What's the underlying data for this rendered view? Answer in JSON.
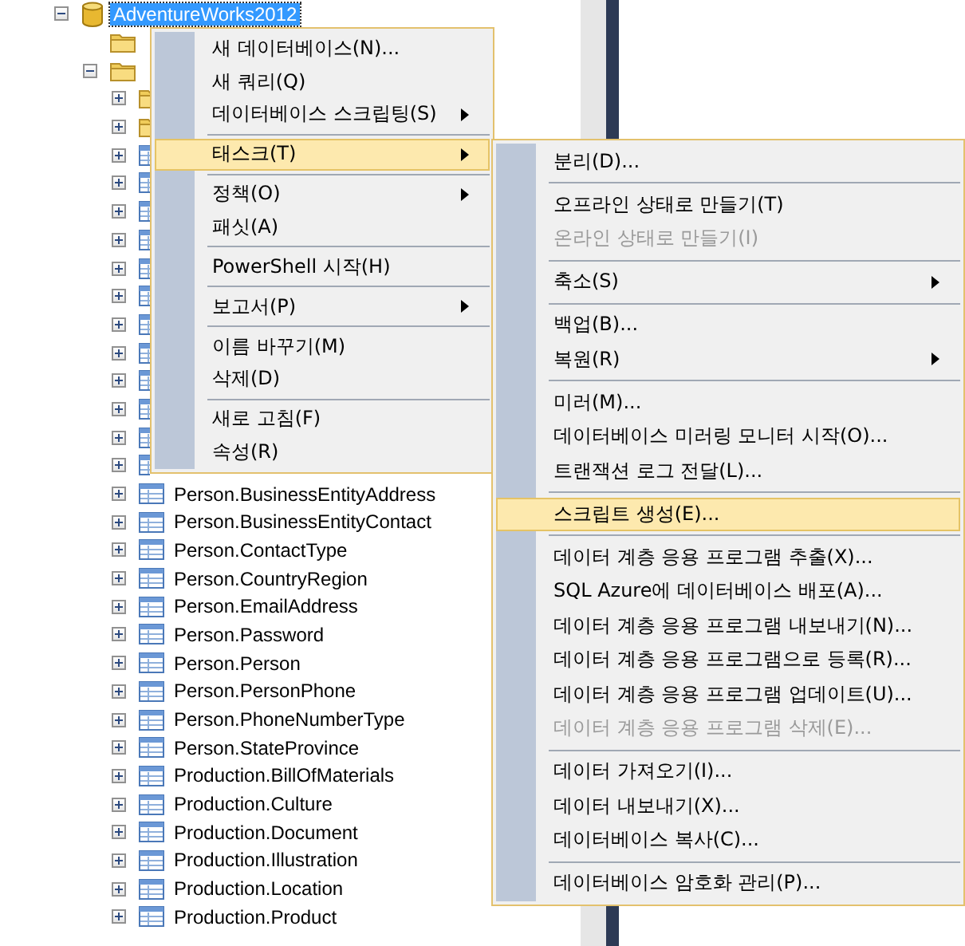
{
  "tree": {
    "nodes": [
      {
        "label": "AdventureWorks2012",
        "kind": "database",
        "expanded": true,
        "selected": true,
        "children": [
          {
            "kind": "folder"
          },
          {
            "kind": "folder",
            "expanded": true,
            "children": [
              {
                "kind": "folder",
                "expanded": false
              },
              {
                "kind": "folder",
                "expanded": false
              },
              {
                "kind": "table",
                "expanded": false
              },
              {
                "kind": "table",
                "expanded": false
              },
              {
                "kind": "table",
                "expanded": false
              },
              {
                "kind": "table",
                "expanded": false
              },
              {
                "kind": "table",
                "expanded": false
              },
              {
                "kind": "table",
                "expanded": false
              },
              {
                "kind": "table",
                "expanded": false
              },
              {
                "kind": "table",
                "expanded": false
              },
              {
                "kind": "table",
                "expanded": false
              },
              {
                "kind": "table",
                "expanded": false
              },
              {
                "kind": "table",
                "expanded": false
              },
              {
                "kind": "table",
                "expanded": false
              },
              {
                "label": "Person.BusinessEntityAddress",
                "kind": "table",
                "expanded": false,
                "selected": false
              },
              {
                "label": "Person.BusinessEntityContact",
                "kind": "table",
                "expanded": false,
                "selected": false
              },
              {
                "label": "Person.ContactType",
                "kind": "table",
                "expanded": false,
                "selected": false
              },
              {
                "label": "Person.CountryRegion",
                "kind": "table",
                "expanded": false,
                "selected": false
              },
              {
                "label": "Person.EmailAddress",
                "kind": "table",
                "expanded": false,
                "selected": false
              },
              {
                "label": "Person.Password",
                "kind": "table",
                "expanded": false,
                "selected": false
              },
              {
                "label": "Person.Person",
                "kind": "table",
                "expanded": false,
                "selected": false
              },
              {
                "label": "Person.PersonPhone",
                "kind": "table",
                "expanded": false,
                "selected": false
              },
              {
                "label": "Person.PhoneNumberType",
                "kind": "table",
                "expanded": false,
                "selected": false
              },
              {
                "label": "Person.StateProvince",
                "kind": "table",
                "expanded": false,
                "selected": false
              },
              {
                "label": "Production.BillOfMaterials",
                "kind": "table",
                "expanded": false,
                "selected": false
              },
              {
                "label": "Production.Culture",
                "kind": "table",
                "expanded": false,
                "selected": false
              },
              {
                "label": "Production.Document",
                "kind": "table",
                "expanded": false,
                "selected": false
              },
              {
                "label": "Production.Illustration",
                "kind": "table",
                "expanded": false,
                "selected": false
              },
              {
                "label": "Production.Location",
                "kind": "table",
                "expanded": false,
                "selected": false
              },
              {
                "label": "Production.Product",
                "kind": "table",
                "expanded": false,
                "selected": false
              }
            ]
          }
        ]
      }
    ]
  },
  "context_menu": {
    "items": [
      {
        "kind": "item",
        "label": "새 데이터베이스(N)...",
        "submenu": false,
        "disabled": false,
        "selected": false
      },
      {
        "kind": "item",
        "label": "새 쿼리(Q)",
        "submenu": false,
        "disabled": false,
        "selected": false
      },
      {
        "kind": "item",
        "label": "데이터베이스 스크립팅(S)",
        "submenu": true,
        "disabled": false,
        "selected": false
      },
      {
        "kind": "separator"
      },
      {
        "kind": "item",
        "label": "태스크(T)",
        "submenu": true,
        "disabled": false,
        "selected": true
      },
      {
        "kind": "separator"
      },
      {
        "kind": "item",
        "label": "정책(O)",
        "submenu": true,
        "disabled": false,
        "selected": false
      },
      {
        "kind": "item",
        "label": "패싯(A)",
        "submenu": false,
        "disabled": false,
        "selected": false
      },
      {
        "kind": "separator"
      },
      {
        "kind": "item",
        "label": "PowerShell 시작(H)",
        "submenu": false,
        "disabled": false,
        "selected": false
      },
      {
        "kind": "separator"
      },
      {
        "kind": "item",
        "label": "보고서(P)",
        "submenu": true,
        "disabled": false,
        "selected": false
      },
      {
        "kind": "separator"
      },
      {
        "kind": "item",
        "label": "이름 바꾸기(M)",
        "submenu": false,
        "disabled": false,
        "selected": false
      },
      {
        "kind": "item",
        "label": "삭제(D)",
        "submenu": false,
        "disabled": false,
        "selected": false
      },
      {
        "kind": "separator"
      },
      {
        "kind": "item",
        "label": "새로 고침(F)",
        "submenu": false,
        "disabled": false,
        "selected": false
      },
      {
        "kind": "item",
        "label": "속성(R)",
        "submenu": false,
        "disabled": false,
        "selected": false
      }
    ]
  },
  "submenu": {
    "items": [
      {
        "kind": "item",
        "label": "분리(D)...",
        "submenu": false,
        "disabled": false,
        "selected": false
      },
      {
        "kind": "separator"
      },
      {
        "kind": "item",
        "label": "오프라인 상태로 만들기(T)",
        "submenu": false,
        "disabled": false,
        "selected": false
      },
      {
        "kind": "item",
        "label": "온라인 상태로 만들기(I)",
        "submenu": false,
        "disabled": true,
        "selected": false
      },
      {
        "kind": "separator"
      },
      {
        "kind": "item",
        "label": "축소(S)",
        "submenu": true,
        "disabled": false,
        "selected": false
      },
      {
        "kind": "separator"
      },
      {
        "kind": "item",
        "label": "백업(B)...",
        "submenu": false,
        "disabled": false,
        "selected": false
      },
      {
        "kind": "item",
        "label": "복원(R)",
        "submenu": true,
        "disabled": false,
        "selected": false
      },
      {
        "kind": "separator"
      },
      {
        "kind": "item",
        "label": "미러(M)...",
        "submenu": false,
        "disabled": false,
        "selected": false
      },
      {
        "kind": "item",
        "label": "데이터베이스 미러링 모니터 시작(O)...",
        "submenu": false,
        "disabled": false,
        "selected": false
      },
      {
        "kind": "item",
        "label": "트랜잭션 로그 전달(L)...",
        "submenu": false,
        "disabled": false,
        "selected": false
      },
      {
        "kind": "separator"
      },
      {
        "kind": "item",
        "label": "스크립트 생성(E)...",
        "submenu": false,
        "disabled": false,
        "selected": true
      },
      {
        "kind": "separator"
      },
      {
        "kind": "item",
        "label": "데이터 계층 응용 프로그램 추출(X)...",
        "submenu": false,
        "disabled": false,
        "selected": false
      },
      {
        "kind": "item",
        "label": "SQL Azure에 데이터베이스 배포(A)...",
        "submenu": false,
        "disabled": false,
        "selected": false
      },
      {
        "kind": "item",
        "label": "데이터 계층 응용 프로그램 내보내기(N)...",
        "submenu": false,
        "disabled": false,
        "selected": false
      },
      {
        "kind": "item",
        "label": "데이터 계층 응용 프로그램으로 등록(R)...",
        "submenu": false,
        "disabled": false,
        "selected": false
      },
      {
        "kind": "item",
        "label": "데이터 계층 응용 프로그램 업데이트(U)...",
        "submenu": false,
        "disabled": false,
        "selected": false
      },
      {
        "kind": "item",
        "label": "데이터 계층 응용 프로그램 삭제(E)...",
        "submenu": false,
        "disabled": true,
        "selected": false
      },
      {
        "kind": "separator"
      },
      {
        "kind": "item",
        "label": "데이터 가져오기(I)...",
        "submenu": false,
        "disabled": false,
        "selected": false
      },
      {
        "kind": "item",
        "label": "데이터 내보내기(X)...",
        "submenu": false,
        "disabled": false,
        "selected": false
      },
      {
        "kind": "item",
        "label": "데이터베이스 복사(C)...",
        "submenu": false,
        "disabled": false,
        "selected": false
      },
      {
        "kind": "separator"
      },
      {
        "kind": "item",
        "label": "데이터베이스 암호화 관리(P)...",
        "submenu": false,
        "disabled": false,
        "selected": false
      }
    ]
  }
}
